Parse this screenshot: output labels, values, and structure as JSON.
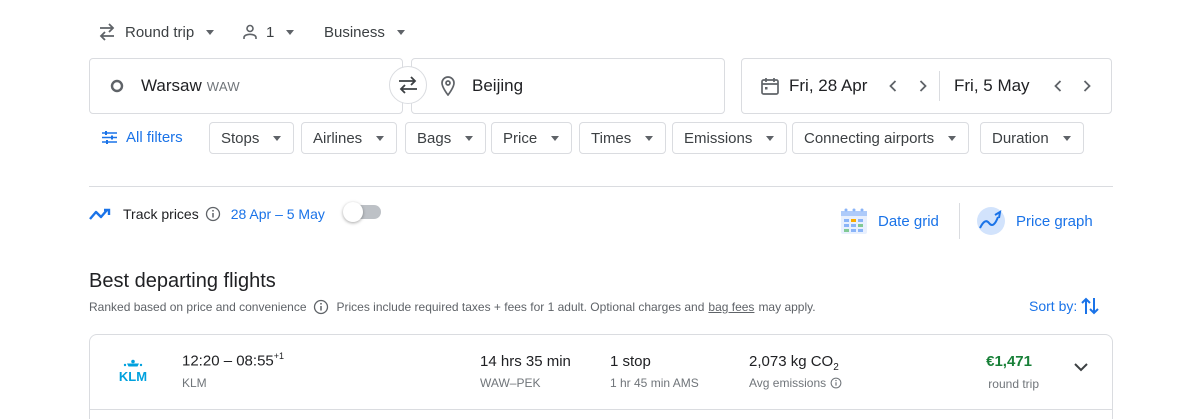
{
  "top": {
    "trip_type": "Round trip",
    "passengers": "1",
    "cabin": "Business"
  },
  "search": {
    "from_city": "Warsaw",
    "from_code": "WAW",
    "to_city": "Beijing",
    "depart_date": "Fri, 28 Apr",
    "return_date": "Fri, 5 May"
  },
  "filters": {
    "all_filters": "All filters",
    "chips": [
      "Stops",
      "Airlines",
      "Bags",
      "Price",
      "Times",
      "Emissions",
      "Connecting airports",
      "Duration"
    ]
  },
  "track": {
    "label": "Track prices",
    "dates": "28 Apr – 5 May",
    "enabled": false
  },
  "tools": {
    "date_grid": "Date grid",
    "price_graph": "Price graph"
  },
  "results": {
    "title": "Best departing flights",
    "ranked": "Ranked based on price and convenience",
    "prices_note_pre": "Prices include required taxes + fees for 1 adult. Optional charges and",
    "bag_fees": "bag fees",
    "prices_note_post": "may apply.",
    "sort_by": "Sort by:"
  },
  "flight": {
    "airline_logo": "KLM",
    "times": "12:20 – 08:55",
    "day_offset": "+1",
    "airline": "KLM",
    "duration": "14 hrs 35 min",
    "route": "WAW–PEK",
    "stops": "1 stop",
    "layover": "1 hr 45 min AMS",
    "emissions_value": "2,073 kg CO",
    "emissions_sub": "2",
    "emissions_label": "Avg emissions",
    "price": "€1,471",
    "price_label": "round trip"
  },
  "colors": {
    "accent": "#1a73e8",
    "price_green": "#188038",
    "klm_blue": "#00a1de",
    "border": "#dadce0"
  }
}
